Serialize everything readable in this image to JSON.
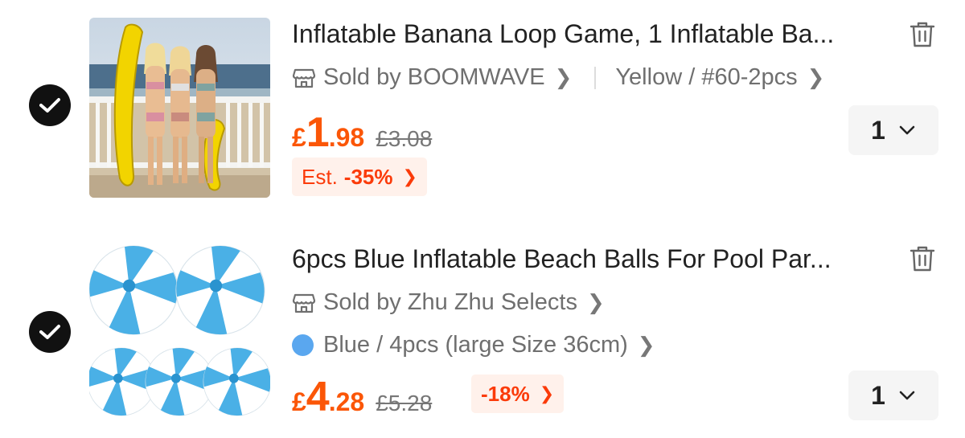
{
  "cart": {
    "items": [
      {
        "selected": true,
        "image_icon": "inflatable-banana-photo",
        "title": "Inflatable Banana Loop Game, 1 Inflatable Ba...",
        "seller": "Sold by BOOMWAVE",
        "variant": "Yellow / #60-2pcs",
        "price_currency": "£",
        "price_major": "1",
        "price_minor": ".98",
        "original_price": "£3.08",
        "discount_prefix": "Est.",
        "discount": "-35%",
        "quantity": "1"
      },
      {
        "selected": true,
        "image_icon": "blue-beach-balls-photo",
        "title": "6pcs Blue Inflatable Beach Balls For Pool Par...",
        "seller": "Sold by Zhu Zhu Selects",
        "variant": "Blue / 4pcs (large Size 36cm)",
        "variant_color": "#5aa7ef",
        "price_currency": "£",
        "price_major": "4",
        "price_minor": ".28",
        "original_price": "£5.28",
        "discount": "-18%",
        "quantity": "1"
      }
    ]
  },
  "colors": {
    "price": "#fb5607",
    "badge_bg": "#fff1eb",
    "check_bg": "#111111"
  }
}
